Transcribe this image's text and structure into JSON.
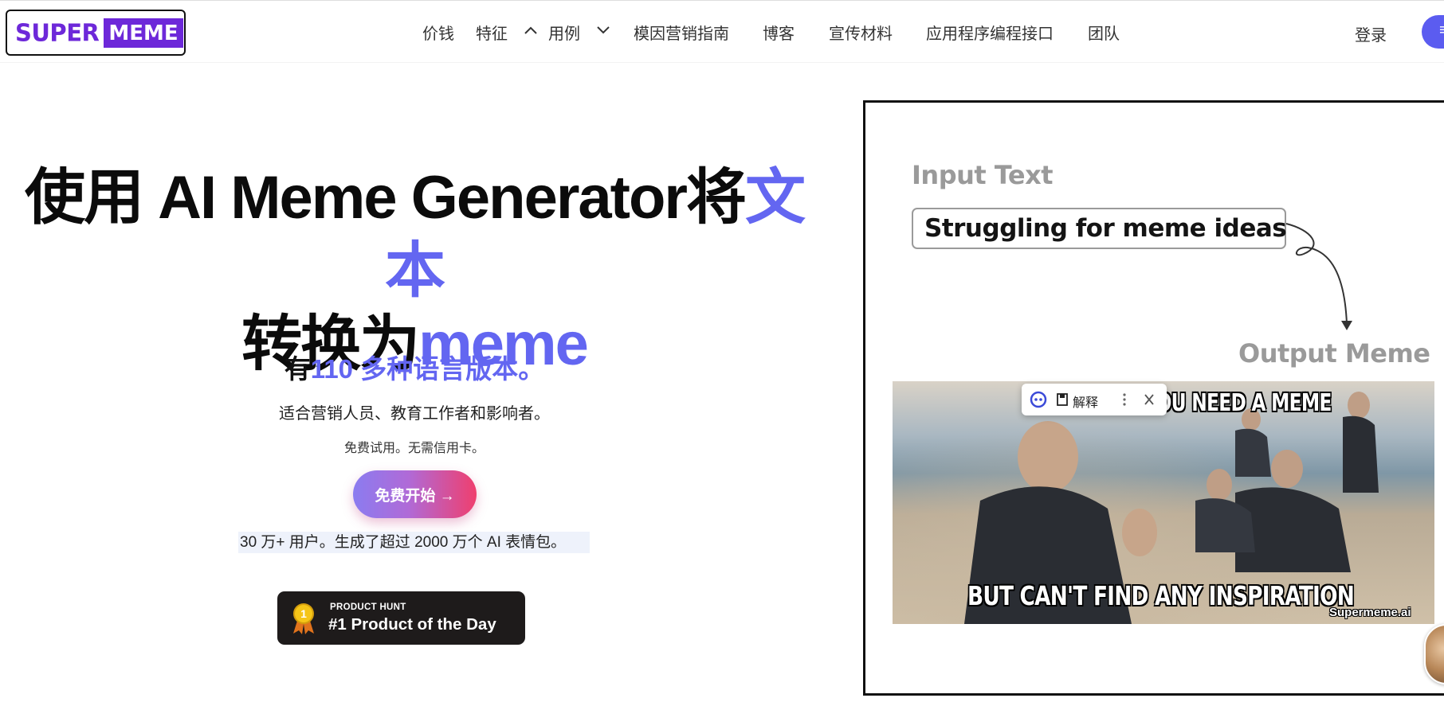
{
  "logo": {
    "super": "SUPER",
    "meme": "MEME"
  },
  "nav": {
    "items": [
      "价钱",
      "特征",
      "用例",
      "模因营销指南",
      "博客",
      "宣传材料",
      "应用程序编程接口",
      "团队"
    ],
    "login": "登录",
    "cta_icon": "≡"
  },
  "hero": {
    "title_part1": "使用 AI Meme Generator将",
    "title_accent1": "文本",
    "title_part2": "转换为",
    "title_accent2": "meme",
    "languages_prefix": "有",
    "languages_accent": "110 多种语言版本。",
    "audience": "适合营销人员、教育工作者和影响者。",
    "free_note": "免费试用。无需信用卡。",
    "start_button": "免费开始 →",
    "stats": "30 万+ 用户。生成了超过 2000 万个 AI 表情包。"
  },
  "product_hunt": {
    "small": "PRODUCT HUNT",
    "big": "#1 Product of the Day",
    "medal_number": "1"
  },
  "demo": {
    "input_label": "Input Text",
    "input_value": "Struggling for meme ideas",
    "output_label": "Output Meme",
    "meme_top": "WHEN YOU NEED A MEME",
    "meme_bottom": "BUT CAN'T FIND ANY INSPIRATION",
    "meme_watermark": "Supermeme.ai"
  },
  "popup": {
    "label": "解释"
  },
  "colors": {
    "brand": "#6d28d9",
    "accent": "#6366f1",
    "gradient_start": "#8b7cf0",
    "gradient_end": "#ef3f6e"
  }
}
